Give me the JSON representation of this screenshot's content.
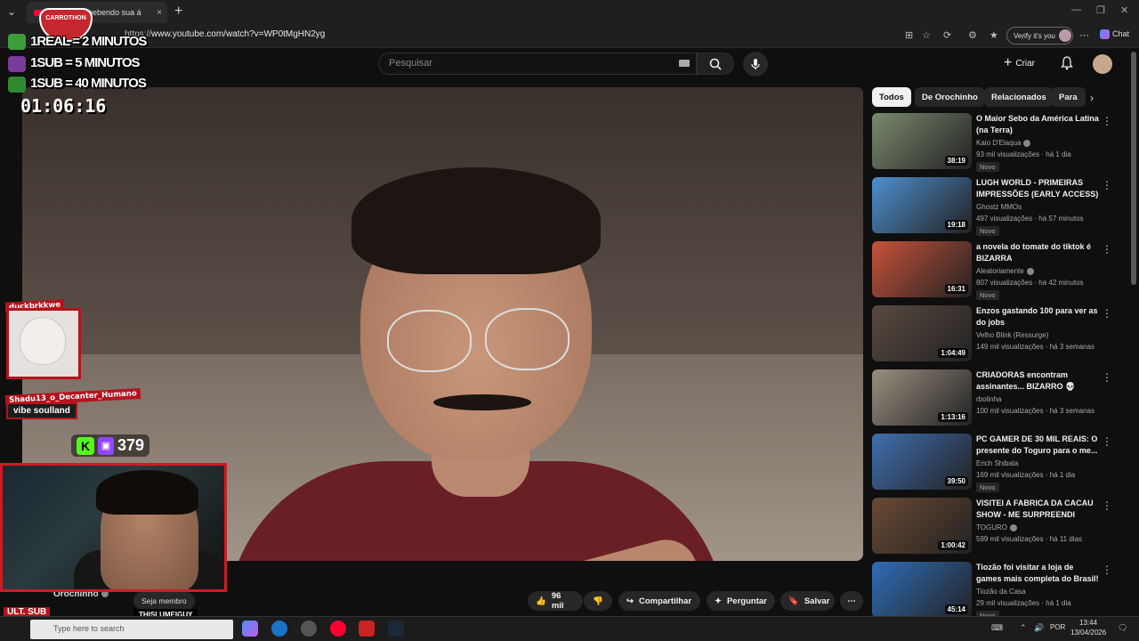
{
  "browser": {
    "tab_title": "Vo... estão bebendo sua á",
    "tab_close": "×",
    "new_tab": "+",
    "url_prefix": "https://",
    "url_main": "www.youtube.com/watch?v=WP0tMgHN2yg",
    "verify_label": "Verify it's you",
    "chat_label": "Chat",
    "menu_dots": "⋯"
  },
  "youtube": {
    "search_placeholder": "Pesquisar",
    "create_label": "Criar",
    "chips": [
      "Todos",
      "De Orochinho",
      "Relacionados",
      "Para"
    ],
    "channel_name": "Orochinho",
    "join_label": "Seja membro",
    "likes": "96 mil",
    "share_label": "Compartilhar",
    "ask_label": "Perguntar",
    "save_label": "Salvar",
    "more_label": "⋯"
  },
  "recommendations": [
    {
      "title": "O Maior Sebo da América Latina (na Terra)",
      "channel": "Kaio D'Elaqua",
      "verified": true,
      "meta": "93 mil visualizações · há 1 dia",
      "badge": "Novo",
      "duration": "38:19",
      "thumb_color": "#7b8a6f"
    },
    {
      "title": "LUGH WORLD - PRIMEIRAS IMPRESSÕES (EARLY ACCESS)",
      "channel": "Ghostz MMOs",
      "verified": false,
      "meta": "497 visualizações · há 57 minutos",
      "badge": "Novo",
      "duration": "19:18",
      "thumb_color": "#4d8fd1"
    },
    {
      "title": "a novela do tomate do tiktok é BIZARRA",
      "channel": "Aleatoriamente",
      "verified": true,
      "meta": "807 visualizações · há 42 minutos",
      "badge": "Novo",
      "duration": "16:31",
      "thumb_color": "#c8523a"
    },
    {
      "title": "Enzos gastando 100 para ver as do jobs",
      "channel": "Velho Blink (Ressurge)",
      "verified": false,
      "meta": "149 mil visualizações · há 3 semanas",
      "badge": "",
      "duration": "1:04:49",
      "thumb_color": "#5a4a40"
    },
    {
      "title": "CRIADORAS encontram assinantes... BIZARRO 💀",
      "channel": "rbolinha",
      "verified": false,
      "meta": "100 mil visualizações · há 3 semanas",
      "badge": "",
      "duration": "1:13:16",
      "thumb_color": "#9a8f80"
    },
    {
      "title": "PC GAMER DE 30 MIL REAIS: O presente do Toguro para o me...",
      "channel": "Erich Shibata",
      "verified": false,
      "meta": "169 mil visualizações · há 1 dia",
      "badge": "Novo",
      "duration": "39:50",
      "thumb_color": "#3f6fb0"
    },
    {
      "title": "VISITEI A FABRICA DA CACAU SHOW - ME SURPREENDI",
      "channel": "TOGURO",
      "verified": true,
      "meta": "599 mil visualizações · há 11 dias",
      "badge": "",
      "duration": "1:00:42",
      "thumb_color": "#6a4a34"
    },
    {
      "title": "Tiozão foi visitar a loja de games mais completa do Brasil!",
      "channel": "Tiozão da Casa",
      "verified": false,
      "meta": "29 mil visualizações · há 1 dia",
      "badge": "Novo",
      "duration": "45:14",
      "thumb_color": "#2f6db8"
    }
  ],
  "overlay": {
    "event_logo": "CARROTHON",
    "lines": [
      "1REAL = 2 MINUTOS",
      "1SUB = 5 MINUTOS",
      "1SUB = 40 MINUTOS"
    ],
    "timer": "01:06:16",
    "chat": [
      {
        "user": "duckbrkkwe",
        "message": ""
      },
      {
        "user": "Shadu13_o_Decanter_Humano",
        "message": "vibe soulland"
      }
    ],
    "viewers": "379",
    "kick_letter": "K",
    "ult_sub": "ULT. SUB",
    "brand": "THISLUMEIGUY"
  },
  "taskbar": {
    "search_placeholder": "Type here to search",
    "language": "POR",
    "time": "13:44",
    "date": "13/04/2026"
  },
  "colors": {
    "accent_red": "#b5131d",
    "kick_green": "#53fc18",
    "twitch_purple": "#9146ff",
    "youtube_red": "#ff0033"
  }
}
